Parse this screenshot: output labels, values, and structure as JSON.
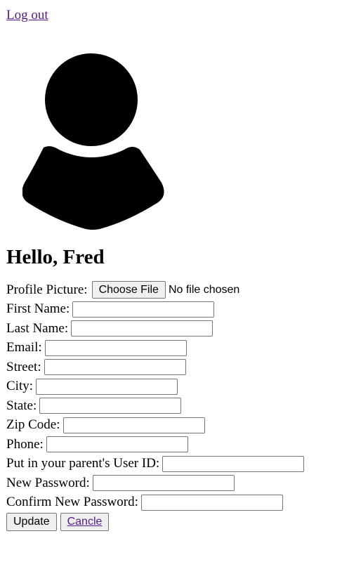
{
  "header": {
    "logout_label": "Log out"
  },
  "avatar": {
    "icon": "user-silhouette-icon"
  },
  "greeting": "Hello, Fred",
  "form": {
    "profile_picture_label": "Profile Picture:",
    "choose_file_label": "Choose File",
    "file_status": "No file chosen",
    "fields": {
      "first_name": {
        "label": "First Name:",
        "value": ""
      },
      "last_name": {
        "label": "Last Name:",
        "value": ""
      },
      "email": {
        "label": "Email:",
        "value": ""
      },
      "street": {
        "label": "Street:",
        "value": ""
      },
      "city": {
        "label": "City:",
        "value": ""
      },
      "state": {
        "label": "State:",
        "value": ""
      },
      "zip_code": {
        "label": "Zip Code:",
        "value": ""
      },
      "phone": {
        "label": "Phone:",
        "value": ""
      },
      "parent_user_id": {
        "label": "Put in your parent's User ID:",
        "value": ""
      },
      "new_password": {
        "label": "New Password:",
        "value": ""
      },
      "confirm_new_password": {
        "label": "Confirm New Password:",
        "value": ""
      }
    },
    "update_label": "Update",
    "cancel_label": "Cancle"
  },
  "colors": {
    "link": "#551a8b",
    "button_bg": "#efefef",
    "input_border": "#767676"
  }
}
